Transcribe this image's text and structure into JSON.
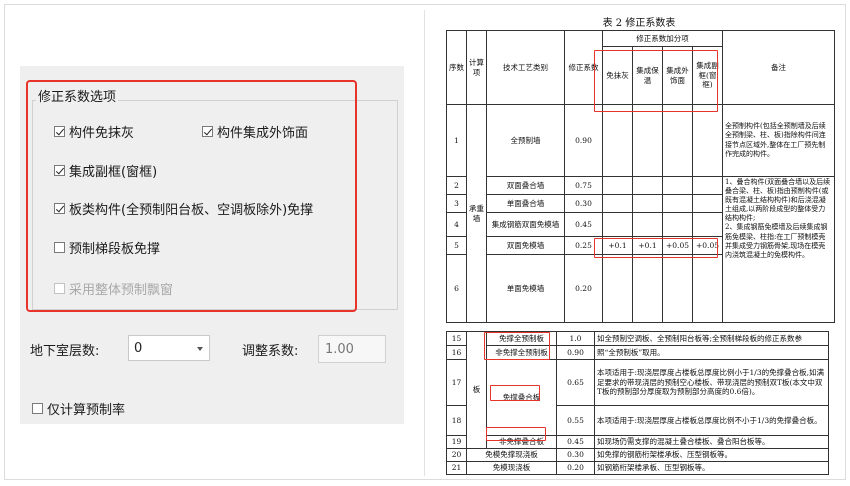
{
  "panel": {
    "group_title": "修正系数选项",
    "options": [
      {
        "label": "构件免抹灰",
        "checked": true,
        "enabled": true
      },
      {
        "label": "构件集成外饰面",
        "checked": true,
        "enabled": true
      },
      {
        "label": "集成副框(窗框)",
        "checked": true,
        "enabled": true
      },
      {
        "label": "板类构件(全预制阳台板、空调板除外)免撑",
        "checked": true,
        "enabled": true
      },
      {
        "label": "预制梯段板免撑",
        "checked": false,
        "enabled": true
      },
      {
        "label": "采用整体预制飘窗",
        "checked": false,
        "enabled": false
      }
    ],
    "basement_label": "地下室层数:",
    "basement_value": "0",
    "adjust_label": "调整系数:",
    "adjust_value": "1.00",
    "prefab_rate_only": {
      "label": "仅计算预制率",
      "checked": false
    }
  },
  "doc": {
    "title": "表 2  修正系数表",
    "table1": {
      "headers": {
        "seq": "序数",
        "calc": "计算项",
        "tech": "技术工艺类别",
        "coef": "修正系数",
        "addon": "修正系数加分项",
        "addon_cols": [
          "免抹灰",
          "集成保温",
          "集成外饰面",
          "集成副框(窗框)"
        ],
        "remark": "备注"
      },
      "group_label": "承重墙",
      "rows": [
        {
          "seq": "1",
          "type": "全预制墙",
          "coef": "0.90"
        },
        {
          "seq": "2",
          "type": "双面叠合墙",
          "coef": "0.75"
        },
        {
          "seq": "3",
          "type": "单面叠合墙",
          "coef": "0.30"
        },
        {
          "seq": "4",
          "type": "集成钢筋双面免模墙",
          "coef": "0.45"
        },
        {
          "seq": "5",
          "type": "双面免模墙",
          "coef": "0.25",
          "addons": [
            "+0.1",
            "+0.1",
            "+0.05",
            "+0.05"
          ]
        },
        {
          "seq": "6",
          "type": "单面免模墙",
          "coef": "0.20"
        }
      ],
      "remark1": "全预制构件(包括全预制墙及后续全预制梁、柱、板)指除构件间连接节点区域外,整体在工厂预先制作完成的构件。",
      "remark2": "1、叠合构件(双面叠合墙以及后续叠合梁、柱、板)指由预制构件(或既有混凝土结构构件)和后浇混凝土组成,以两阶段成型的整体受力结构构件;",
      "remark3": "2、集成钢筋免模墙及后续集成钢筋免模梁、柱指:在工厂预制模壳并集成受力钢筋骨架,现场在模壳内浇筑混凝土的免模构件。"
    },
    "table2": {
      "group_label": "板",
      "rows": [
        {
          "seq": "15",
          "type": "免撑全预制板",
          "coef": "1.0",
          "note": "如全预制空调板、全预制阳台板等;全预制梯段板的修正系数参"
        },
        {
          "seq": "16",
          "type": "非免撑全预制板",
          "coef": "0.90",
          "note": "照“全预制板”取用。"
        },
        {
          "seq": "17",
          "type": "免撑叠合板",
          "coef": "0.65",
          "note": "本项适用于:现浇层厚度占楼板总厚度比例小于1/3的免撑叠合板,如满足要求的带现浇层的预制空心楼板、带现浇层的预制双T板(本文中双T板的预制部分厚度取为预制部分高度的0.6倍)。"
        },
        {
          "seq": "18",
          "type": "",
          "coef": "0.55",
          "note": "本项适用于:现浇层厚度占楼板总厚度比例不小于1/3的免撑叠合板。"
        },
        {
          "seq": "19",
          "type": "非免撑叠合板",
          "coef": "0.45",
          "note": "如现场仍需支撑的混凝土叠合楼板、叠合阳台板等。"
        },
        {
          "seq": "20",
          "type": "免模免撑现浇板",
          "coef": "0.30",
          "note": "如免撑的钢筋桁架楼承板、压型钢板等。"
        },
        {
          "seq": "21",
          "type": "免模现浇板",
          "coef": "0.20",
          "note": "如钢筋桁架楼承板、压型钢板等。"
        }
      ]
    }
  }
}
